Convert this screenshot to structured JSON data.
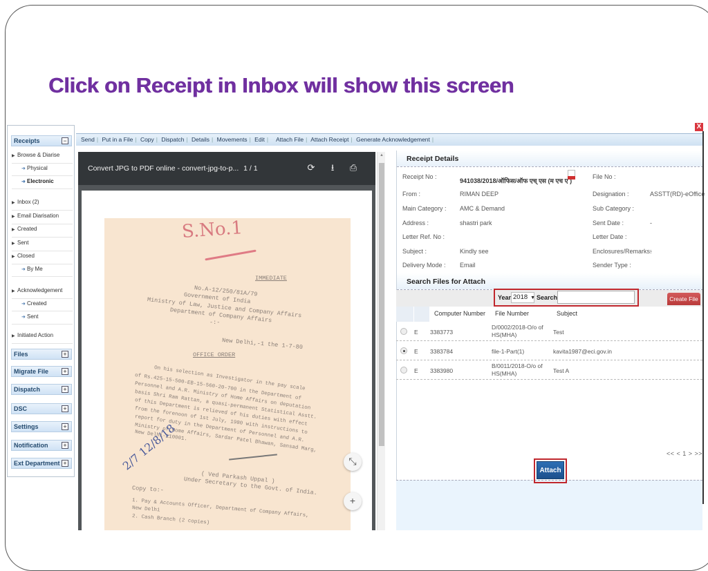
{
  "slide": {
    "title": "Click on Receipt in Inbox will show this screen"
  },
  "sidebar": {
    "receipts_header": "Receipts",
    "receipts_toggle": "−",
    "items": [
      {
        "label": "Browse & Diarise",
        "type": "parent"
      },
      {
        "label": "Physical",
        "type": "sub"
      },
      {
        "label": "Electronic",
        "type": "sub",
        "selected": true
      },
      {
        "label": "Inbox (2)",
        "type": "parent"
      },
      {
        "label": "Email Diarisation",
        "type": "parent"
      },
      {
        "label": "Created",
        "type": "parent"
      },
      {
        "label": "Sent",
        "type": "parent"
      },
      {
        "label": "Closed",
        "type": "parent"
      },
      {
        "label": "By Me",
        "type": "sub"
      },
      {
        "label": "Acknowledgement",
        "type": "parent"
      },
      {
        "label": "Created",
        "type": "sub"
      },
      {
        "label": "Sent",
        "type": "sub"
      },
      {
        "label": "Initiated Action",
        "type": "parent"
      }
    ],
    "sections": [
      {
        "label": "Files",
        "toggle": "+"
      },
      {
        "label": "Migrate File",
        "toggle": "+"
      },
      {
        "label": "Dispatch",
        "toggle": "+"
      },
      {
        "label": "DSC",
        "toggle": "+"
      },
      {
        "label": "Settings",
        "toggle": "+"
      },
      {
        "label": "Notification",
        "toggle": "+"
      },
      {
        "label": "Ext Department",
        "toggle": "+"
      }
    ]
  },
  "toolbar": {
    "items": [
      "Send",
      "Put in a File",
      "Copy",
      "Dispatch",
      "Details",
      "Movements",
      "Edit",
      "Attach File",
      "Attach Receipt",
      "Generate Acknowledgement"
    ],
    "close_label": "X"
  },
  "viewer": {
    "doc_title": "Convert JPG to PDF online - convert-jpg-to-p...",
    "page_indicator": "1  /  1",
    "rotate_icon": "⟳",
    "download_icon": "⭳",
    "print_icon": "⎙",
    "fit_icon": "⤡",
    "zoom_in_icon": "+",
    "document": {
      "stamp": "S.No.1",
      "header_tag": "IMMEDIATE",
      "lines": [
        "No.A-12/250/81A/79",
        "Government of India",
        "Ministry of Law, Justice and Company Affairs",
        "Department of Company Affairs",
        "-:-",
        "New Delhi,-1 the 1-7-80",
        "OFFICE ORDER",
        "On his selection as Investigator in the pay scale",
        "of Rs.425-15-500-EB-15-560-20-700 in the Department of",
        "Personnel and A.R. Ministry of Home Affairs on deputation",
        "basis Shri Ram Rattan, a quasi-permanent Statistical Asstt.",
        "of this Department is relieved of his duties with effect",
        "from the forenoon of 1st July, 1980 with instructions to",
        "report for duty in the Department of Personnel and A.R.",
        "Ministry of Home Affairs, Sardar Patel Bhawan, Sansad Marg,",
        "New Delhi-110001.",
        "( Ved Parkash Uppal )",
        "Under Secretary to the Govt. of India.",
        "Copy to:-",
        "1.   Pay & Accounts Officer, Department of Company Affairs,",
        "     New Delhi",
        "2.   Cash Branch (2 copies)"
      ],
      "handwritten_note": "2/7 12/8/18"
    }
  },
  "receipt_details": {
    "heading": "Receipt Details",
    "left": [
      {
        "label": "Receipt No :",
        "value": "941038/2018/ऑफिस/ऑफ एच् एस (म एच ए )"
      },
      {
        "label": "From :",
        "value": "RIMAN DEEP"
      },
      {
        "label": "Main Category :",
        "value": "AMC & Demand"
      },
      {
        "label": "Address :",
        "value": "shastri park"
      },
      {
        "label": "Letter Ref. No :",
        "value": ""
      },
      {
        "label": "Subject :",
        "value": "Kindly see"
      },
      {
        "label": "Delivery Mode :",
        "value": "Email"
      }
    ],
    "right": [
      {
        "label": "File No :",
        "value": ""
      },
      {
        "label": "Designation :",
        "value": "ASSTT(RD)-eOffice"
      },
      {
        "label": "Sub Category :",
        "value": ""
      },
      {
        "label": "Sent Date :",
        "value": "-"
      },
      {
        "label": "Letter Date :",
        "value": ""
      },
      {
        "label": "Enclosures/Remarks:",
        "value": "-"
      },
      {
        "label": "Sender Type :",
        "value": ""
      }
    ]
  },
  "search_files": {
    "heading": "Search Files for Attach",
    "year_label": "Year",
    "year_value": "2018",
    "search_label": "Search",
    "search_value": "",
    "create_file_label": "Create File",
    "columns": [
      "Computer Number",
      "File Number",
      "Subject"
    ],
    "rows": [
      {
        "selected": false,
        "type": "E",
        "computer_number": "3383773",
        "file_number": "D/0002/2018-O/o of HS(MHA)",
        "subject": "Test"
      },
      {
        "selected": true,
        "type": "E",
        "computer_number": "3383784",
        "file_number": "file-1-Part(1)",
        "subject": "kavita1987@eci.gov.in"
      },
      {
        "selected": false,
        "type": "E",
        "computer_number": "3383980",
        "file_number": "B/0011/2018-O/o of HS(MHA)",
        "subject": "Test A"
      }
    ],
    "pager": "<< < 1 > >>",
    "attach_label": "Attach"
  },
  "colors": {
    "title_purple": "#7030a0",
    "highlight_red": "#c0272d",
    "attach_blue": "#2d6fb5",
    "create_file_red": "#c94848"
  }
}
